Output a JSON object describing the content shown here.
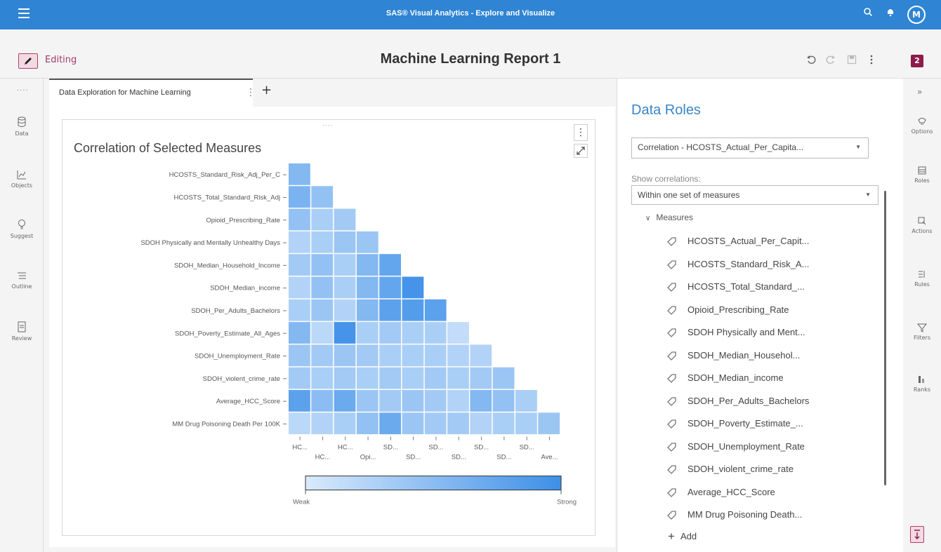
{
  "app": {
    "title": "SAS® Visual Analytics - Explore and Visualize",
    "avatar_initial": "M"
  },
  "report": {
    "editing_label": "Editing",
    "title": "Machine Learning Report 1",
    "page_badge": "2"
  },
  "left_nav": [
    {
      "label": "Data",
      "icon": "database-icon"
    },
    {
      "label": "Objects",
      "icon": "chart-icon"
    },
    {
      "label": "Suggest",
      "icon": "lightbulb-icon"
    },
    {
      "label": "Outline",
      "icon": "list-icon"
    },
    {
      "label": "Review",
      "icon": "document-icon"
    }
  ],
  "tabs": [
    {
      "label": "Data Exploration for Machine Learning"
    }
  ],
  "chart_data": {
    "type": "heatmap",
    "title": "Correlation of Selected Measures",
    "row_labels": [
      "HCOSTS_Standard_Risk_Adj_Per_C",
      "HCOSTS_Total_Standard_Risk_Adj",
      "Opioid_Prescribing_Rate",
      "SDOH Physically and Mentally Unhealthy Days",
      "SDOH_Median_Household_Income",
      "SDOH_Median_income",
      "SDOH_Per_Adults_Bachelors",
      "SDOH_Poverty_Estimate_All_Ages",
      "SDOH_Unemployment_Rate",
      "SDOH_violent_crime_rate",
      "Average_HCC_Score",
      "MM Drug Poisoning Death Per 100K"
    ],
    "column_labels_top": [
      "HC...",
      "HC...",
      "SD...",
      "SD...",
      "SD...",
      "SD..."
    ],
    "column_labels_bottom": [
      "HC...",
      "Opi...",
      "SD...",
      "SD...",
      "SD...",
      "Ave..."
    ],
    "values": [
      [
        0.55
      ],
      [
        0.6,
        0.45
      ],
      [
        0.45,
        0.3,
        0.35
      ],
      [
        0.25,
        0.3,
        0.4,
        0.4
      ],
      [
        0.35,
        0.45,
        0.3,
        0.55,
        0.75
      ],
      [
        0.25,
        0.45,
        0.3,
        0.55,
        0.75,
        0.95
      ],
      [
        0.3,
        0.4,
        0.25,
        0.55,
        0.8,
        0.85,
        0.8
      ],
      [
        0.55,
        0.2,
        0.95,
        0.3,
        0.35,
        0.3,
        0.3,
        0.15
      ],
      [
        0.4,
        0.35,
        0.4,
        0.35,
        0.3,
        0.3,
        0.3,
        0.25,
        0.25
      ],
      [
        0.35,
        0.3,
        0.35,
        0.3,
        0.35,
        0.3,
        0.35,
        0.3,
        0.35,
        0.4
      ],
      [
        0.8,
        0.5,
        0.7,
        0.4,
        0.35,
        0.4,
        0.35,
        0.25,
        0.55,
        0.45,
        0.3
      ],
      [
        0.2,
        0.25,
        0.3,
        0.45,
        0.7,
        0.4,
        0.35,
        0.35,
        0.25,
        0.3,
        0.3,
        0.4
      ]
    ],
    "legend": {
      "low_label": "Weak",
      "high_label": "Strong"
    },
    "colors": {
      "weak": "#d9eafc",
      "strong": "#3d8fe8"
    }
  },
  "roles": {
    "title": "Data Roles",
    "correlation_dropdown": "Correlation - HCOSTS_Actual_Per_Capita...",
    "show_label": "Show correlations:",
    "show_dropdown": "Within one set of measures",
    "measures_heading": "Measures",
    "measures": [
      "HCOSTS_Actual_Per_Capit...",
      "HCOSTS_Standard_Risk_A...",
      "HCOSTS_Total_Standard_...",
      "Opioid_Prescribing_Rate",
      "SDOH Physically and Ment...",
      "SDOH_Median_Househol...",
      "SDOH_Median_income",
      "SDOH_Per_Adults_Bachelors",
      "SDOH_Poverty_Estimate_...",
      "SDOH_Unemployment_Rate",
      "SDOH_violent_crime_rate",
      "Average_HCC_Score",
      "MM Drug Poisoning Death..."
    ],
    "add_label": "Add"
  },
  "right_nav": [
    {
      "label": "Options"
    },
    {
      "label": "Roles"
    },
    {
      "label": "Actions"
    },
    {
      "label": "Rules"
    },
    {
      "label": "Filters"
    },
    {
      "label": "Ranks"
    }
  ],
  "colors": {
    "topbar": "#2f84d3",
    "accent": "#3a86c8",
    "editing": "#a23c66"
  }
}
